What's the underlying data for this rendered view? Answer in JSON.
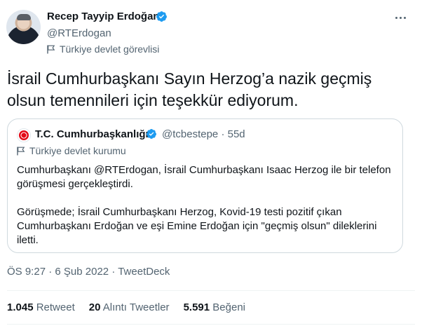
{
  "author": {
    "name": "Recep Tayyip Erdoğan",
    "handle": "@RTErdogan",
    "label": "Türkiye devlet görevlisi",
    "verified": true
  },
  "tweet": {
    "text": "İsrail Cumhurbaşkanı Sayın Herzog’a nazik geçmiş olsun temennileri için teşekkür ediyorum."
  },
  "quoted": {
    "name": "T.C. Cumhurbaşkanlığı",
    "handle": "@tcbestepe",
    "separator": "·",
    "age": "55d",
    "label": "Türkiye devlet kurumu",
    "paragraph1": "Cumhurbaşkanı @RTErdogan, İsrail Cumhurbaşkanı Isaac Herzog ile bir telefon görüşmesi gerçekleştirdi.",
    "paragraph2": "Görüşmede; İsrail Cumhurbaşkanı Herzog, Kovid-19 testi pozitif çıkan Cumhurbaşkanı Erdoğan ve eşi Emine Erdoğan için \"geçmiş olsun\" dileklerini iletti."
  },
  "meta": {
    "time": "ÖS 9:27",
    "date": "6 Şub 2022",
    "separator": "·",
    "source": "TweetDeck"
  },
  "stats": [
    {
      "count": "1.045",
      "label": "Retweet"
    },
    {
      "count": "20",
      "label": "Alıntı Tweetler"
    },
    {
      "count": "5.591",
      "label": "Beğeni"
    }
  ],
  "colors": {
    "verified": "#1d9bf0",
    "secondary_text": "#536471",
    "border": "#cfd9de"
  },
  "icons": {
    "verified": "verified-badge-icon",
    "label": "flag-icon",
    "more": "more-dots-icon"
  }
}
